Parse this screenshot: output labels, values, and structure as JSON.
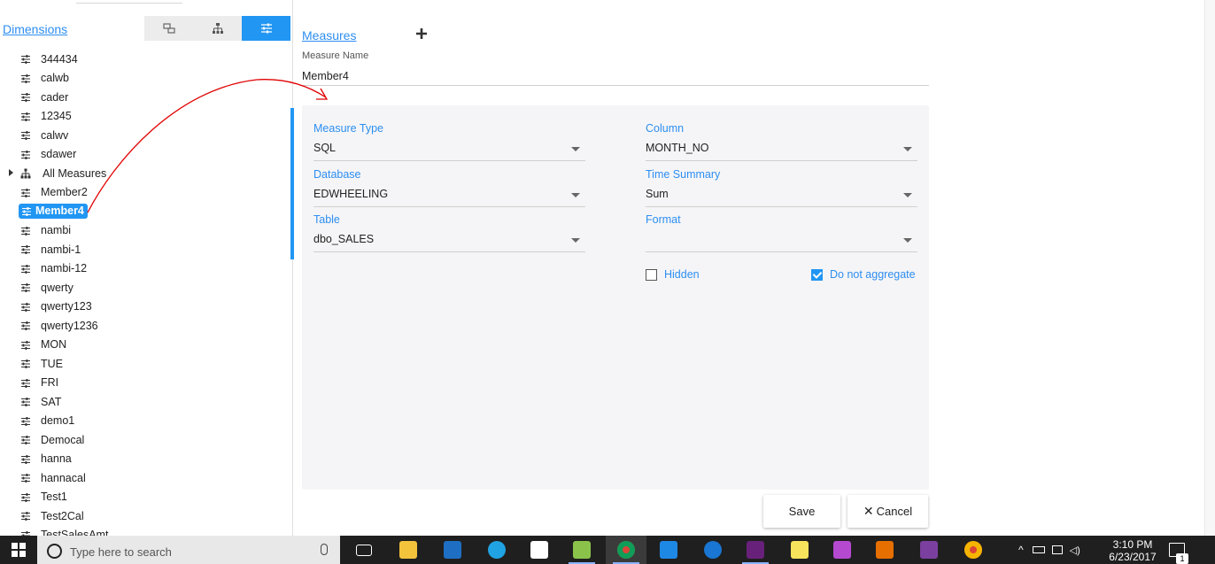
{
  "left_panel": {
    "dimensions_link": "Dimensions",
    "view_tabs": [
      {
        "name": "detail-view",
        "active": false
      },
      {
        "name": "hierarchy-view",
        "active": false
      },
      {
        "name": "measures-view",
        "active": true
      }
    ],
    "tree_items": [
      {
        "label": "344434",
        "type": "measure"
      },
      {
        "label": "calwb",
        "type": "measure"
      },
      {
        "label": "cader",
        "type": "measure"
      },
      {
        "label": "12345",
        "type": "measure"
      },
      {
        "label": "calwv",
        "type": "measure"
      },
      {
        "label": "sdawer",
        "type": "measure"
      },
      {
        "label": "All Measures",
        "type": "group"
      },
      {
        "label": "Member2",
        "type": "measure"
      },
      {
        "label": "Member4",
        "type": "measure",
        "selected": true
      },
      {
        "label": "nambi",
        "type": "measure"
      },
      {
        "label": "nambi-1",
        "type": "measure"
      },
      {
        "label": "nambi-12",
        "type": "measure"
      },
      {
        "label": "qwerty",
        "type": "measure"
      },
      {
        "label": "qwerty123",
        "type": "measure"
      },
      {
        "label": "qwerty1236",
        "type": "measure"
      },
      {
        "label": "MON",
        "type": "measure"
      },
      {
        "label": "TUE",
        "type": "measure"
      },
      {
        "label": "FRI",
        "type": "measure"
      },
      {
        "label": "SAT",
        "type": "measure"
      },
      {
        "label": "demo1",
        "type": "measure"
      },
      {
        "label": "Democal",
        "type": "measure"
      },
      {
        "label": "hanna",
        "type": "measure"
      },
      {
        "label": "hannacal",
        "type": "measure"
      },
      {
        "label": "Test1",
        "type": "measure"
      },
      {
        "label": "Test2Cal",
        "type": "measure"
      },
      {
        "label": "TestSalesAmt",
        "type": "measure"
      }
    ]
  },
  "main": {
    "measures_link": "Measures",
    "measure_name_label": "Measure Name",
    "measure_name_value": "Member4",
    "form": {
      "measure_type_label": "Measure Type",
      "measure_type_value": "SQL",
      "database_label": "Database",
      "database_value": "EDWHEELING",
      "table_label": "Table",
      "table_value": "dbo_SALES",
      "column_label": "Column",
      "column_value": "MONTH_NO",
      "time_summary_label": "Time Summary",
      "time_summary_value": "Sum",
      "format_label": "Format",
      "format_value": "",
      "hidden_label": "Hidden",
      "hidden_checked": false,
      "do_not_aggregate_label": "Do not aggregate",
      "do_not_aggregate_checked": true
    },
    "save_label": "Save",
    "cancel_label": "Cancel"
  },
  "taskbar": {
    "search_placeholder": "Type here to search",
    "time": "3:10 PM",
    "date": "6/23/2017",
    "notification_count": "1",
    "apps": [
      "task-view-icon",
      "file-explorer-icon",
      "outlook-icon",
      "skype-icon",
      "store-icon",
      "notepadpp-icon",
      "chrome-icon",
      "vs-code-icon",
      "edge-icon",
      "visual-studio-icon",
      "sticky-notes-icon",
      "paint-icon",
      "java-icon",
      "app-icon",
      "chrome-icon-2"
    ]
  },
  "colors": {
    "accent": "#2196f3",
    "link": "#2d8ef0",
    "annotation": "#e00000"
  }
}
